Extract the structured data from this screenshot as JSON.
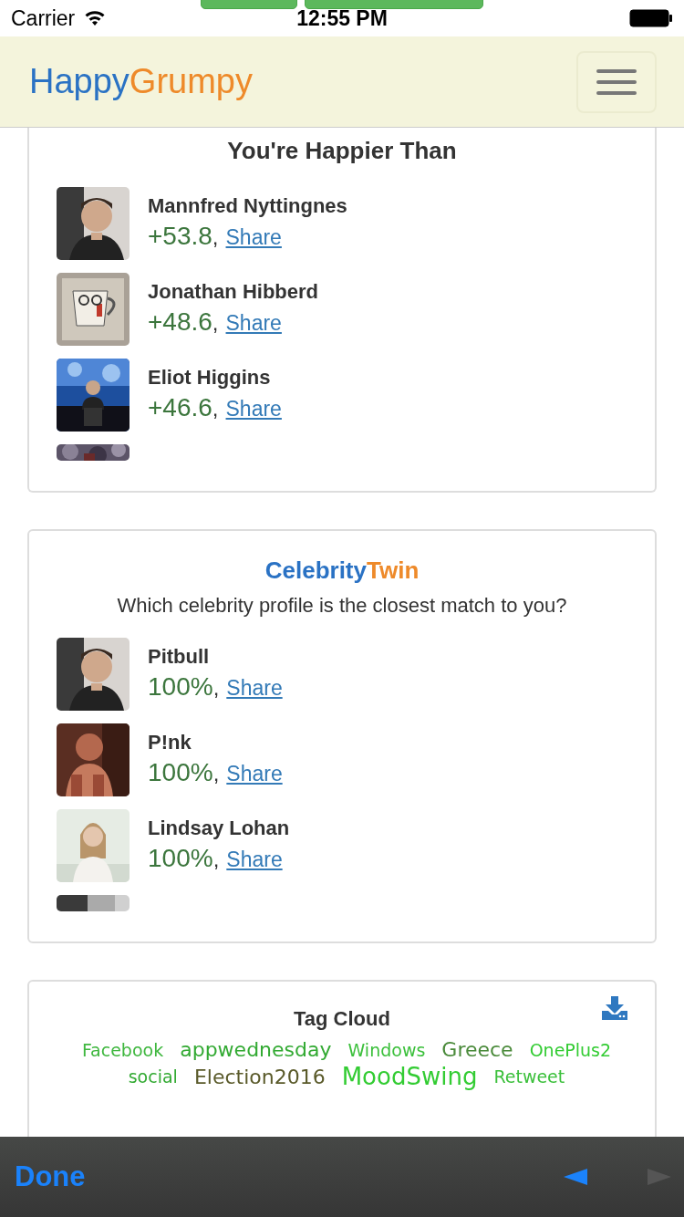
{
  "status_bar": {
    "carrier": "Carrier",
    "time": "12:55 PM"
  },
  "navbar": {
    "brand": [
      {
        "text": "Happy",
        "color": "#2a72c4"
      },
      {
        "text": "Grumpy",
        "color": "#ee8a2a"
      }
    ]
  },
  "happier_card": {
    "title": "You're Happier Than",
    "people": [
      {
        "name": "Mannfred Nyttingnes",
        "score": "+53.8",
        "separator": ",",
        "share": "Share",
        "kind": "portrait"
      },
      {
        "name": "Jonathan Hibberd",
        "score": "+48.6",
        "separator": ",",
        "share": "Share",
        "kind": "cup"
      },
      {
        "name": "Eliot Higgins",
        "score": "+46.6",
        "separator": ",",
        "share": "Share",
        "kind": "stage"
      }
    ],
    "cut_thumbnail": {
      "kind": "crowd"
    }
  },
  "celebrity_card": {
    "title": [
      {
        "text": "Celebrity",
        "color": "#2a72c4"
      },
      {
        "text": "Twin",
        "color": "#ee8a2a"
      }
    ],
    "subtitle": "Which celebrity profile is the closest match to you?",
    "people": [
      {
        "name": "Pitbull",
        "score": "100%",
        "separator": ",",
        "share": "Share",
        "kind": "portrait"
      },
      {
        "name": "P!nk",
        "score": "100%",
        "separator": ",",
        "share": "Share",
        "kind": "warm"
      },
      {
        "name": "Lindsay Lohan",
        "score": "100%",
        "separator": ",",
        "share": "Share",
        "kind": "light"
      }
    ],
    "cut_thumbnail": {
      "kind": "grey"
    }
  },
  "tag_cloud": {
    "title": "Tag Cloud",
    "tags": [
      {
        "text": "Facebook",
        "color": "#3fb73f",
        "kind": "small"
      },
      {
        "text": "appwednesday",
        "color": "#33aa33",
        "kind": "medium"
      },
      {
        "text": "Windows",
        "color": "#3cc03c",
        "kind": "small"
      },
      {
        "text": "Greece",
        "color": "#4a8a3a",
        "kind": "medium"
      },
      {
        "text": "OnePlus2",
        "color": "#33cc33",
        "kind": "small"
      },
      {
        "text": "social",
        "color": "#33aa33",
        "kind": "small"
      },
      {
        "text": "Election2016",
        "color": "#5a5a2a",
        "kind": "medium"
      },
      {
        "text": "MoodSwing",
        "color": "#33cc33",
        "kind": "large"
      },
      {
        "text": "Retweet",
        "color": "#3cc03c",
        "kind": "small"
      }
    ]
  },
  "toolbar": {
    "done": "Done",
    "back": {
      "disabled": false
    },
    "forward": {
      "disabled": true
    }
  }
}
